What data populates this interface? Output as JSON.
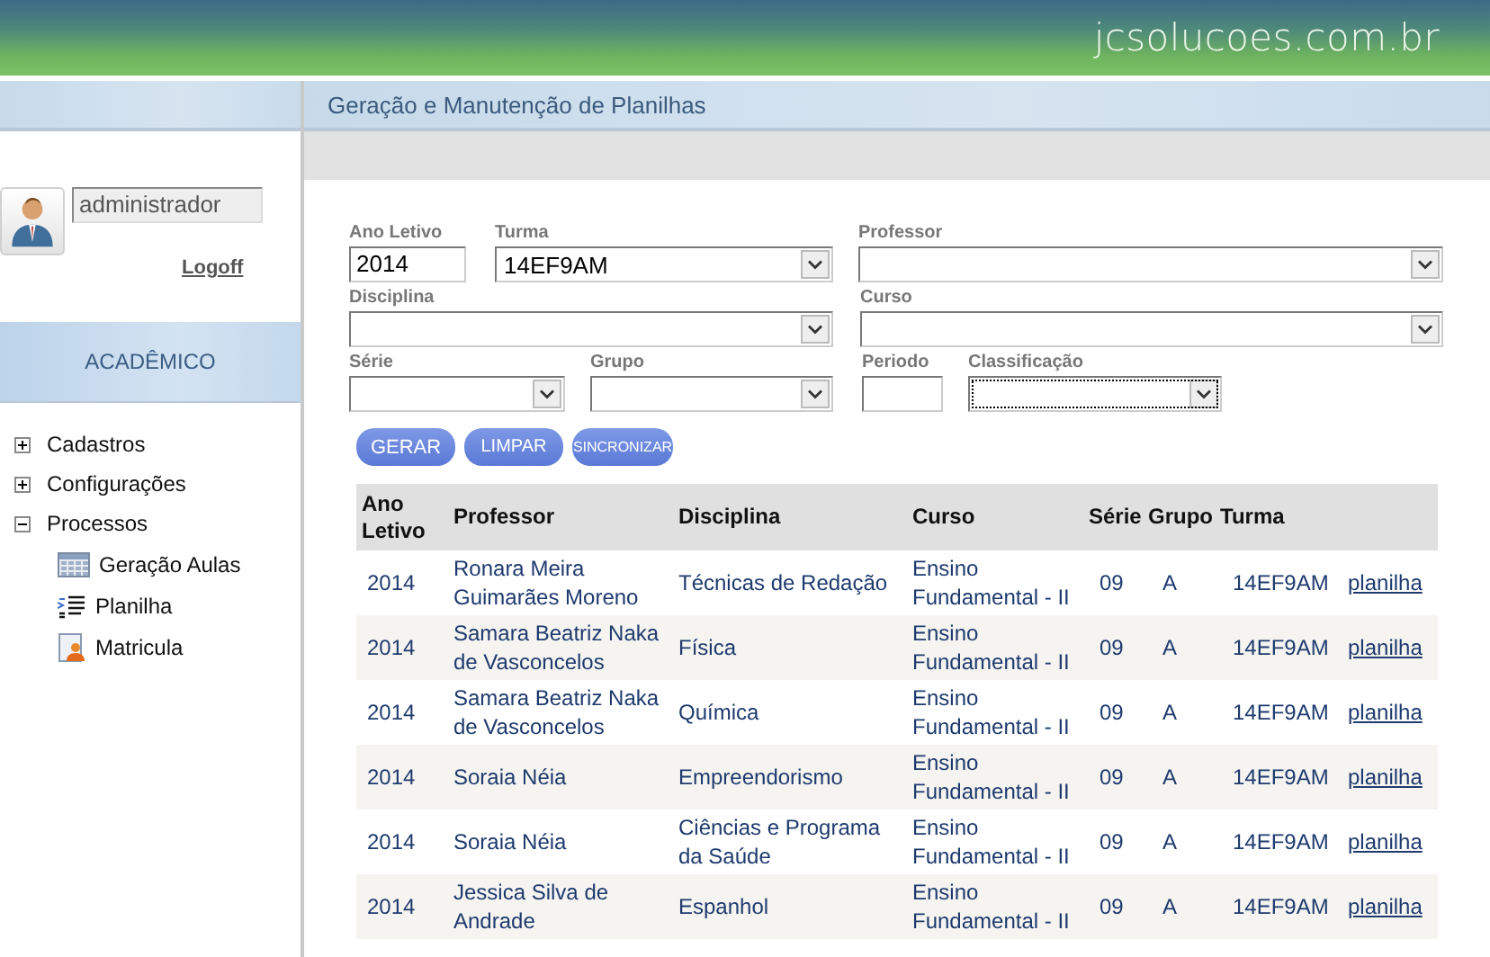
{
  "header": {
    "site": "jcsolucoes.com.br"
  },
  "user": {
    "name": "administrador",
    "logout": "Logoff"
  },
  "sidebar": {
    "section": "ACADÊMICO",
    "items": [
      {
        "label": "Cadastros",
        "expanded": false
      },
      {
        "label": "Configurações",
        "expanded": false
      },
      {
        "label": "Processos",
        "expanded": true,
        "children": [
          {
            "label": "Geração Aulas",
            "kind": "calendar"
          },
          {
            "label": "Planilha",
            "kind": "list"
          },
          {
            "label": "Matricula",
            "kind": "clipboard"
          }
        ]
      }
    ]
  },
  "page": {
    "title": "Geração e Manutenção de Planilhas"
  },
  "form": {
    "fields": [
      {
        "label": "Ano Letivo",
        "kind": "text",
        "value": "2014",
        "focused": false
      },
      {
        "label": "Turma",
        "kind": "select",
        "value": "14EF9AM",
        "focused": false
      },
      {
        "label": "Professor",
        "kind": "select",
        "focused": false
      },
      {
        "label": "Disciplina",
        "kind": "select",
        "focused": false
      },
      {
        "label": "Curso",
        "kind": "select",
        "focused": false
      },
      {
        "label": "Série",
        "kind": "select",
        "focused": false
      },
      {
        "label": "Grupo",
        "kind": "select",
        "focused": false
      },
      {
        "label": "Periodo",
        "kind": "text",
        "focused": false
      },
      {
        "label": "Classificação",
        "kind": "select",
        "focused": true
      }
    ],
    "buttons": [
      "GERAR",
      "LIMPAR",
      "SINCRONIZAR"
    ]
  },
  "table": {
    "columns": [
      "Ano Letivo",
      "Professor",
      "Disciplina",
      "Curso",
      "Série",
      "Grupo",
      "Turma"
    ],
    "rows": [
      {
        "cells": [
          "2014",
          "Ronara Meira Guimarães Moreno",
          "Técnicas de Redação",
          "Ensino Fundamental - II",
          "09",
          "A",
          "14EF9AM"
        ],
        "link": "planilha"
      },
      {
        "cells": [
          "2014",
          "Samara Beatriz Naka de Vasconcelos",
          "Física",
          "Ensino Fundamental - II",
          "09",
          "A",
          "14EF9AM"
        ],
        "link": "planilha"
      },
      {
        "cells": [
          "2014",
          "Samara Beatriz Naka de Vasconcelos",
          "Química",
          "Ensino Fundamental - II",
          "09",
          "A",
          "14EF9AM"
        ],
        "link": "planilha"
      },
      {
        "cells": [
          "2014",
          "Soraia Néia",
          "Empreendorismo",
          "Ensino Fundamental - II",
          "09",
          "A",
          "14EF9AM"
        ],
        "link": "planilha"
      },
      {
        "cells": [
          "2014",
          "Soraia Néia",
          "Ciências e Programa da Saúde",
          "Ensino Fundamental - II",
          "09",
          "A",
          "14EF9AM"
        ],
        "link": "planilha"
      },
      {
        "cells": [
          "2014",
          "Jessica Silva de Andrade",
          "Espanhol",
          "Ensino Fundamental - II",
          "09",
          "A",
          "14EF9AM"
        ],
        "link": "planilha"
      }
    ]
  }
}
